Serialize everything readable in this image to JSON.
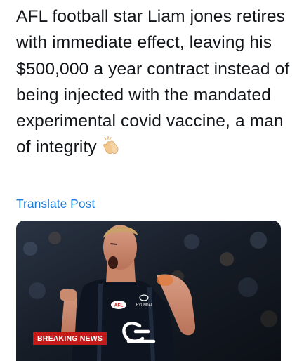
{
  "post": {
    "text": "AFL football star Liam jones retires with immediate effect, leaving his $500,000 a year contract instead of being injected with the mandated experimental covid vaccine, a man of integrity",
    "emoji": "clapping-hands-emoji",
    "translate_label": "Translate Post"
  },
  "media": {
    "badge": "BREAKING NEWS",
    "jersey_brand": "HYUNDAI",
    "jersey_league_logo": "AFL"
  },
  "colors": {
    "text": "#111418",
    "link": "#1d7bd6",
    "badge": "#c41a1a"
  }
}
